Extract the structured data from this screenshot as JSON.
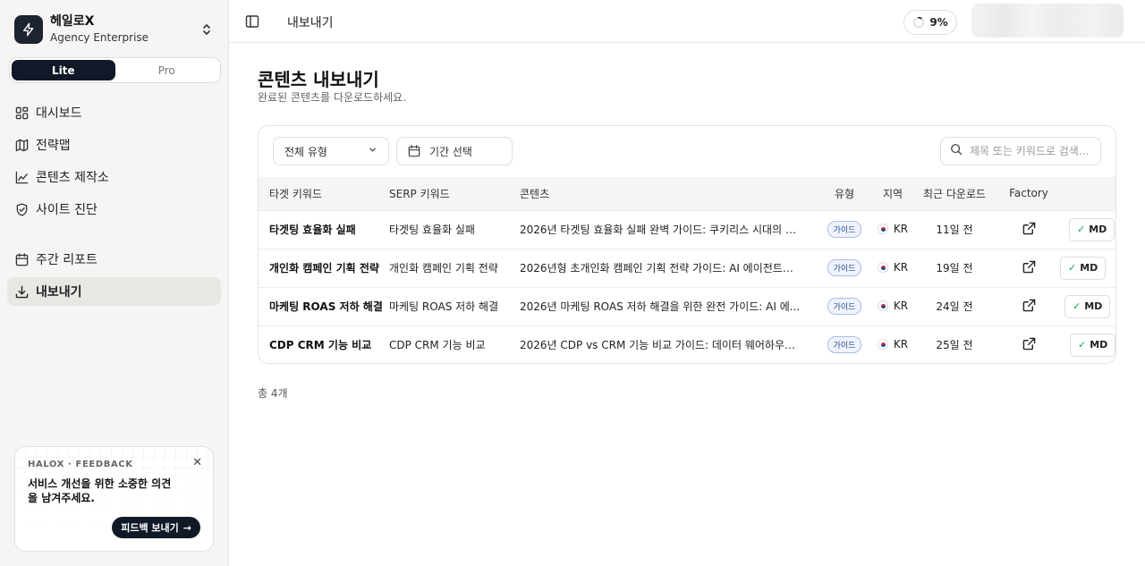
{
  "sidebar": {
    "brand_name": "헤일로X",
    "brand_plan": "Agency Enterprise",
    "modes": [
      "Lite",
      "Pro"
    ],
    "nav_primary": [
      {
        "label": "대시보드",
        "icon": "dashboard-grid-icon"
      },
      {
        "label": "전략맵",
        "icon": "map-icon"
      },
      {
        "label": "콘텐츠 제작소",
        "icon": "chart-icon"
      },
      {
        "label": "사이트 진단",
        "icon": "shield-check-icon"
      }
    ],
    "nav_secondary": [
      {
        "label": "주간 리포트",
        "icon": "calendar-icon"
      },
      {
        "label": "내보내기",
        "icon": "download-icon"
      }
    ],
    "feedback": {
      "tag": "HALOX · FEEDBACK",
      "message": "서비스 개선을 위한 소중한 의견을 남겨주세요.",
      "button": "피드백 보내기"
    }
  },
  "topbar": {
    "crumb": "내보내기",
    "progress": "9%",
    "progress_value": 0.09
  },
  "main": {
    "title": "콘텐츠 내보내기",
    "subtitle": "완료된 콘텐츠를 다운로드하세요.",
    "filters": {
      "type_label": "전체 유형",
      "date_label": "기간 선택",
      "search_placeholder": "제목 또는 키워드로 검색..."
    },
    "columns": [
      "타겟 키워드",
      "SERP 키워드",
      "콘텐츠",
      "유형",
      "지역",
      "최근 다운로드",
      "Factory"
    ],
    "rows": [
      {
        "keyword": "타겟팅 효율화 실패",
        "serp": "타겟팅 효율화 실패",
        "content": "2026년 타겟팅 효율화 실패 완벽 가이드: 쿠키리스 시대의 퍼...",
        "type": "가이드",
        "region": "KR",
        "downloaded": "11일 전",
        "md": "MD"
      },
      {
        "keyword": "개인화 캠페인 기획 전략",
        "serp": "개인화 캠페인 기획 전략",
        "content": "2026년형 초개인화 캠페인 기획 전략 가이드: AI 에이전트와 ...",
        "type": "가이드",
        "region": "KR",
        "downloaded": "19일 전",
        "md": "MD"
      },
      {
        "keyword": "마케팅 ROAS 저하 해결",
        "serp": "마케팅 ROAS 저하 해결",
        "content": "2026년 마케팅 ROAS 저하 해결을 위한 완전 가이드: AI 에...",
        "type": "가이드",
        "region": "KR",
        "downloaded": "24일 전",
        "md": "MD"
      },
      {
        "keyword": "CDP CRM 기능 비교",
        "serp": "CDP CRM 기능 비교",
        "content": "2026년 CDP vs CRM 기능 비교 가이드: 데이터 웨어하우스...",
        "type": "가이드",
        "region": "KR",
        "downloaded": "25일 전",
        "md": "MD"
      }
    ],
    "total": "총 4개"
  }
}
